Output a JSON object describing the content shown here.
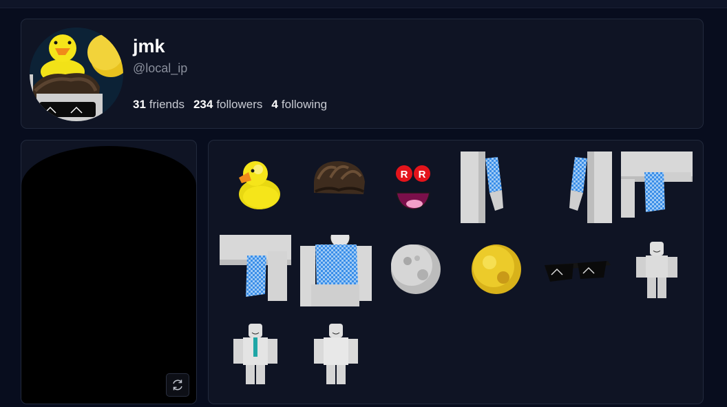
{
  "profile": {
    "display_name": "jmk",
    "username": "@local_ip",
    "stats": [
      {
        "count": "31",
        "label": "friends"
      },
      {
        "count": "234",
        "label": "followers"
      },
      {
        "count": "4",
        "label": "following"
      }
    ]
  },
  "items": [
    {
      "icon": "rubber-duck-icon"
    },
    {
      "icon": "brown-hair-icon"
    },
    {
      "icon": "roblox-face-icon"
    },
    {
      "icon": "right-arm-checkered-icon"
    },
    {
      "icon": "left-arm-checkered-icon"
    },
    {
      "icon": "left-leg-checkered-icon"
    },
    {
      "icon": "right-leg-checkered-icon"
    },
    {
      "icon": "checkered-shirt-icon"
    },
    {
      "icon": "moon-icon"
    },
    {
      "icon": "gold-orb-icon"
    },
    {
      "icon": "sunglasses-icon"
    },
    {
      "icon": "white-avatar-icon"
    },
    {
      "icon": "suit-outfit-icon"
    },
    {
      "icon": "white-outfit-icon"
    }
  ],
  "colors": {
    "background": "#080d1e",
    "card": "#0f1424",
    "border": "#222a3d",
    "duck_yellow": "#f5e51a",
    "checker_blue": "#3a8ee8"
  }
}
